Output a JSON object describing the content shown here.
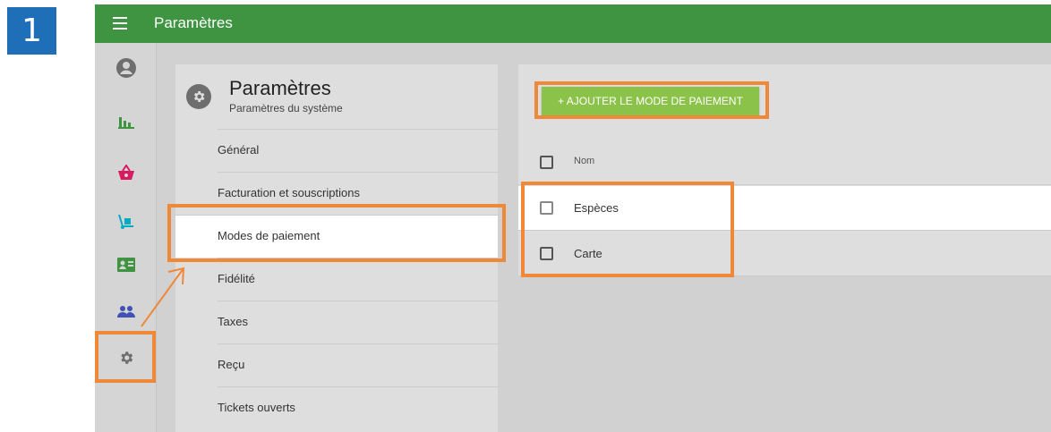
{
  "step": "1",
  "topbar": {
    "title": "Paramètres"
  },
  "rail": {
    "items": [
      {
        "icon": "account-icon",
        "color": "#6e6e6e"
      },
      {
        "icon": "bar-chart-icon",
        "color": "#3e9440"
      },
      {
        "icon": "basket-icon",
        "color": "#d81b60"
      },
      {
        "icon": "dolly-icon",
        "color": "#00acc1"
      },
      {
        "icon": "id-card-icon",
        "color": "#3e9440"
      },
      {
        "icon": "people-icon",
        "color": "#3f51b5"
      },
      {
        "icon": "gear-icon",
        "color": "#6e6e6e"
      }
    ]
  },
  "settings": {
    "title": "Paramètres",
    "subtitle": "Paramètres du système",
    "menu": [
      {
        "label": "Général"
      },
      {
        "label": "Facturation et souscriptions"
      },
      {
        "label": "Modes de paiement",
        "active": true
      },
      {
        "label": "Fidélité"
      },
      {
        "label": "Taxes"
      },
      {
        "label": "Reçu"
      },
      {
        "label": "Tickets ouverts"
      }
    ]
  },
  "payment": {
    "add_button": "+ AJOUTER LE MODE DE PAIEMENT",
    "column_name": "Nom",
    "rows": [
      {
        "name": "Espèces"
      },
      {
        "name": "Carte"
      }
    ]
  },
  "colors": {
    "header_green": "#3e9440",
    "button_green": "#8bc34a",
    "highlight_orange": "#f0883a",
    "step_blue": "#1e6fb8"
  }
}
